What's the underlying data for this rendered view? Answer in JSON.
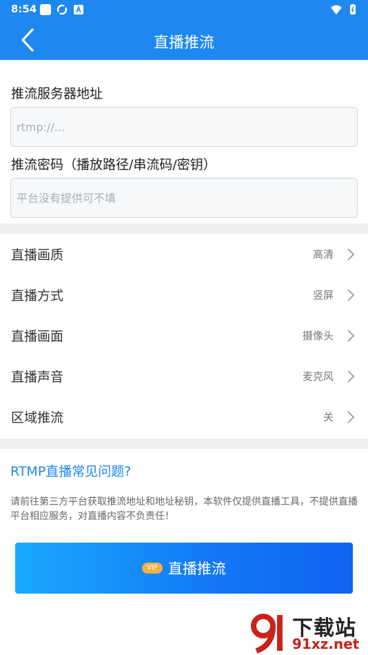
{
  "status_bar": {
    "time": "8:54"
  },
  "header": {
    "title": "直播推流",
    "back_icon": "chevron-left-icon"
  },
  "form": {
    "server_label": "推流服务器地址",
    "server_placeholder": "rtmp://...",
    "server_value": "",
    "key_label": "推流密码（播放路径/串流码/密钥）",
    "key_placeholder": "平台没有提供可不填",
    "key_value": ""
  },
  "settings": [
    {
      "label": "直播画质",
      "value": "高清"
    },
    {
      "label": "直播方式",
      "value": "竖屏"
    },
    {
      "label": "直播画面",
      "value": "摄像头"
    },
    {
      "label": "直播声音",
      "value": "麦克风"
    },
    {
      "label": "区域推流",
      "value": "关"
    }
  ],
  "faq": {
    "link": "RTMP直播常见问题?"
  },
  "notice": "请前往第三方平台获取推流地址和地址秘钥，本软件仅提供直播工具，不提供直播平台相应服务，对直播内容不负责任！",
  "primary_button": {
    "badge": "VIP",
    "label": "直播推流"
  },
  "watermark": {
    "title": "下载站",
    "url": "91xz.net"
  },
  "colors": {
    "brand_blue": "#1e87f0",
    "link_blue": "#1e87f0",
    "vip_orange": "#f2b047",
    "divider_gray": "#eeeff1"
  }
}
